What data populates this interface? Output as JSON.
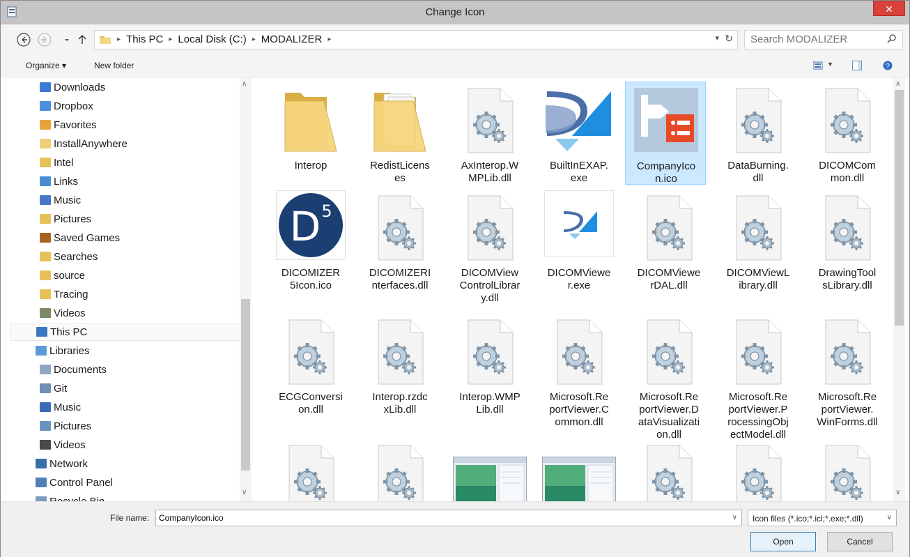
{
  "window": {
    "title": "Change Icon",
    "close_glyph": "✕",
    "app_icon": "document-icon"
  },
  "nav": {
    "back": "back-icon",
    "forward": "forward-icon",
    "recent": "chevron-down-icon",
    "up": "up-arrow-icon"
  },
  "address": {
    "crumbs": [
      "This PC",
      "Local Disk (C:)",
      "MODALIZER"
    ],
    "dropdown_icon": "chevron-down-icon",
    "refresh_icon": "refresh-icon"
  },
  "search": {
    "placeholder": "Search MODALIZER",
    "icon": "search-icon"
  },
  "toolbar": {
    "organize_label": "Organize ▾",
    "new_folder_label": "New folder"
  },
  "sidebar": {
    "items": [
      {
        "label": "Downloads",
        "icon": "downloads-folder-icon",
        "color": "#3b7bd1"
      },
      {
        "label": "Dropbox",
        "icon": "dropbox-icon",
        "color": "#4a8fe0"
      },
      {
        "label": "Favorites",
        "icon": "favorites-folder-icon",
        "color": "#e8a33a"
      },
      {
        "label": "InstallAnywhere",
        "icon": "folder-icon",
        "color": "#efcf78"
      },
      {
        "label": "Intel",
        "icon": "folder-icon",
        "color": "#e6c15a"
      },
      {
        "label": "Links",
        "icon": "links-folder-icon",
        "color": "#4c8ed6"
      },
      {
        "label": "Music",
        "icon": "music-folder-icon",
        "color": "#4a78c4"
      },
      {
        "label": "Pictures",
        "icon": "pictures-folder-icon",
        "color": "#e6c15a"
      },
      {
        "label": "Saved Games",
        "icon": "saved-games-icon",
        "color": "#a8651f"
      },
      {
        "label": "Searches",
        "icon": "searches-folder-icon",
        "color": "#e6c15a"
      },
      {
        "label": "source",
        "icon": "folder-icon",
        "color": "#e6c15a"
      },
      {
        "label": "Tracing",
        "icon": "folder-icon",
        "color": "#e6c15a"
      },
      {
        "label": "Videos",
        "icon": "videos-folder-icon",
        "color": "#7c8a66"
      },
      {
        "label": "This PC",
        "icon": "computer-icon",
        "color": "#3a78c2"
      },
      {
        "label": "Libraries",
        "icon": "libraries-icon",
        "color": "#5a9bd6"
      },
      {
        "label": "Documents",
        "icon": "documents-icon",
        "color": "#8fa7c2"
      },
      {
        "label": "Git",
        "icon": "git-library-icon",
        "color": "#6f8fb3"
      },
      {
        "label": "Music",
        "icon": "music-note-icon",
        "color": "#3d6ab8"
      },
      {
        "label": "Pictures",
        "icon": "pictures-library-icon",
        "color": "#6a93bf"
      },
      {
        "label": "Videos",
        "icon": "videos-library-icon",
        "color": "#4a4a4a"
      },
      {
        "label": "Network",
        "icon": "network-icon",
        "color": "#3a6ea8"
      },
      {
        "label": "Control Panel",
        "icon": "control-panel-icon",
        "color": "#4f7fb8"
      },
      {
        "label": "Recycle Bin",
        "icon": "recycle-bin-icon",
        "color": "#7a9bc0"
      }
    ]
  },
  "files": [
    {
      "name": "Interop",
      "type": "folder"
    },
    {
      "name": "RedistLicenses",
      "type": "folder-docs"
    },
    {
      "name": "AxInterop.WMPLib.dll",
      "type": "dll"
    },
    {
      "name": "BuiltInEXAP.exe",
      "type": "exe-logo"
    },
    {
      "name": "CompanyIcon.ico",
      "type": "company-ico",
      "selected": true
    },
    {
      "name": "DataBurning.dll",
      "type": "dll"
    },
    {
      "name": "DICOMCommon.dll",
      "type": "dll"
    },
    {
      "name": "DICOMIZER5Icon.ico",
      "type": "d5-ico"
    },
    {
      "name": "DICOMIZERInterfaces.dll",
      "type": "dll"
    },
    {
      "name": "DICOMViewControlLibrary.dll",
      "type": "dll"
    },
    {
      "name": "DICOMViewer.exe",
      "type": "exe-small"
    },
    {
      "name": "DICOMViewerDAL.dll",
      "type": "dll"
    },
    {
      "name": "DICOMViewLibrary.dll",
      "type": "dll"
    },
    {
      "name": "DrawingToolsLibrary.dll",
      "type": "dll"
    },
    {
      "name": "ECGConversion.dll",
      "type": "dll"
    },
    {
      "name": "Interop.rzdcxLib.dll",
      "type": "dll"
    },
    {
      "name": "Interop.WMPLib.dll",
      "type": "dll"
    },
    {
      "name": "Microsoft.ReportViewer.Common.dll",
      "type": "dll"
    },
    {
      "name": "Microsoft.ReportViewer.DataVisualization.dll",
      "type": "dll"
    },
    {
      "name": "Microsoft.ReportViewer.ProcessingObjectModel.dll",
      "type": "dll"
    },
    {
      "name": "Microsoft.ReportViewer.WinForms.dll",
      "type": "dll"
    },
    {
      "name": "",
      "type": "dll"
    },
    {
      "name": "",
      "type": "dll"
    },
    {
      "name": "",
      "type": "app-window"
    },
    {
      "name": "",
      "type": "app-window"
    },
    {
      "name": "",
      "type": "dll"
    },
    {
      "name": "",
      "type": "dll"
    },
    {
      "name": "",
      "type": "dll"
    }
  ],
  "file_labels": [
    [
      "Interop"
    ],
    [
      "RedistLicens",
      "es"
    ],
    [
      "AxInterop.W",
      "MPLib.dll"
    ],
    [
      "BuiltInEXAP.",
      "exe"
    ],
    [
      "CompanyIco",
      "n.ico"
    ],
    [
      "DataBurning.",
      "dll"
    ],
    [
      "DICOMCom",
      "mon.dll"
    ],
    [
      "DICOMIZER",
      "5Icon.ico"
    ],
    [
      "DICOMIZERI",
      "nterfaces.dll"
    ],
    [
      "DICOMView",
      "ControlLibrar",
      "y.dll"
    ],
    [
      "DICOMViewe",
      "r.exe"
    ],
    [
      "DICOMViewe",
      "rDAL.dll"
    ],
    [
      "DICOMViewL",
      "ibrary.dll"
    ],
    [
      "DrawingTool",
      "sLibrary.dll"
    ],
    [
      "ECGConversi",
      "on.dll"
    ],
    [
      "Interop.rzdc",
      "xLib.dll"
    ],
    [
      "Interop.WMP",
      "Lib.dll"
    ],
    [
      "Microsoft.Re",
      "portViewer.C",
      "ommon.dll"
    ],
    [
      "Microsoft.Re",
      "portViewer.D",
      "ataVisualizati",
      "on.dll"
    ],
    [
      "Microsoft.Re",
      "portViewer.P",
      "rocessingObj",
      "ectModel.dll"
    ],
    [
      "Microsoft.Re",
      "portViewer.",
      "WinForms.dll"
    ],
    [],
    [],
    [],
    [],
    [],
    [],
    []
  ],
  "bottom": {
    "file_name_label": "File name:",
    "file_name_value": "CompanyIcon.ico",
    "filter_value": "Icon files (*.ico;*.icl;*.exe;*.dll)",
    "open_label": "Open",
    "cancel_label": "Cancel"
  },
  "colors": {
    "selection_bg": "#cce8ff",
    "selection_border": "#99d1ff",
    "close_red": "#d9413a",
    "company_orange": "#e84a27",
    "dicom_blue": "#1c6fb8"
  }
}
